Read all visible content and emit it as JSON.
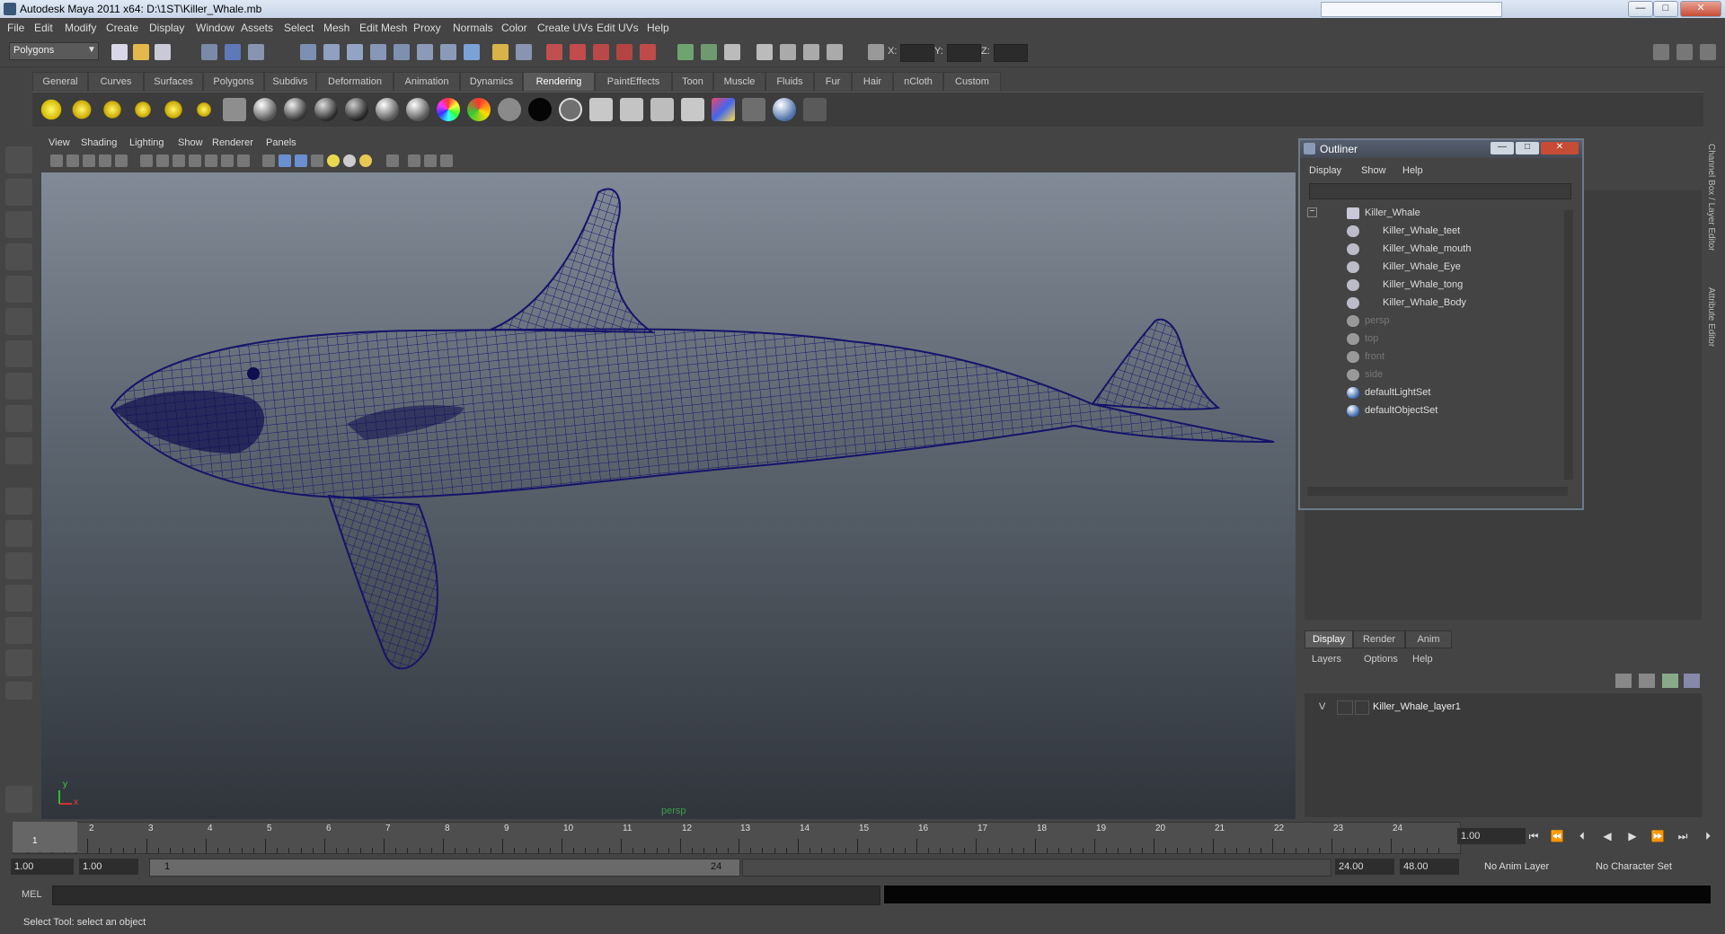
{
  "window": {
    "title": "Autodesk Maya 2011 x64: D:\\1ST\\Killer_Whale.mb",
    "min": "—",
    "max": "□",
    "close": "✕"
  },
  "menubar": [
    "File",
    "Edit",
    "Modify",
    "Create",
    "Display",
    "Window",
    "Assets",
    "Select",
    "Mesh",
    "Edit Mesh",
    "Proxy",
    "Normals",
    "Color",
    "Create UVs",
    "Edit UVs",
    "Help"
  ],
  "statusline": {
    "mode": "Polygons",
    "x_label": "X:",
    "y_label": "Y:",
    "z_label": "Z:"
  },
  "shelf": {
    "tabs": [
      "General",
      "Curves",
      "Surfaces",
      "Polygons",
      "Subdivs",
      "Deformation",
      "Animation",
      "Dynamics",
      "Rendering",
      "PaintEffects",
      "Toon",
      "Muscle",
      "Fluids",
      "Fur",
      "Hair",
      "nCloth",
      "Custom"
    ],
    "active": "Rendering"
  },
  "viewport": {
    "menus": [
      "View",
      "Shading",
      "Lighting",
      "Show",
      "Renderer",
      "Panels"
    ],
    "camera_label": "persp",
    "axis_y": "y",
    "axis_x": "x",
    "wire_color": "#1a1a6e"
  },
  "outliner": {
    "title": "Outliner",
    "menus": [
      "Display",
      "Show",
      "Help"
    ],
    "items": [
      {
        "label": "Killer_Whale",
        "indent": 0,
        "icon": "transform-icon",
        "expand": "−",
        "dim": false
      },
      {
        "label": "Killer_Whale_teet",
        "indent": 1,
        "icon": "mesh-icon",
        "dim": false
      },
      {
        "label": "Killer_Whale_mouth",
        "indent": 1,
        "icon": "mesh-icon",
        "dim": false
      },
      {
        "label": "Killer_Whale_Eye",
        "indent": 1,
        "icon": "mesh-icon",
        "dim": false
      },
      {
        "label": "Killer_Whale_tong",
        "indent": 1,
        "icon": "mesh-icon",
        "dim": false
      },
      {
        "label": "Killer_Whale_Body",
        "indent": 1,
        "icon": "mesh-icon",
        "dim": false
      },
      {
        "label": "persp",
        "indent": 0,
        "icon": "camera-icon",
        "dim": true
      },
      {
        "label": "top",
        "indent": 0,
        "icon": "camera-icon",
        "dim": true
      },
      {
        "label": "front",
        "indent": 0,
        "icon": "camera-icon",
        "dim": true
      },
      {
        "label": "side",
        "indent": 0,
        "icon": "camera-icon",
        "dim": true
      },
      {
        "label": "defaultLightSet",
        "indent": 0,
        "icon": "set-icon",
        "dim": false
      },
      {
        "label": "defaultObjectSet",
        "indent": 0,
        "icon": "set-icon",
        "dim": false
      }
    ]
  },
  "sidetabs": {
    "channel": "Channel Box / Layer Editor",
    "attr": "Attribute Editor"
  },
  "layers": {
    "tabs": [
      "Display",
      "Render",
      "Anim"
    ],
    "active": "Display",
    "menus": [
      "Layers",
      "Options",
      "Help"
    ],
    "rows": [
      {
        "visible": "V",
        "name": "Killer_Whale_layer1"
      }
    ]
  },
  "timeline": {
    "ticks": [
      "1",
      "2",
      "3",
      "4",
      "5",
      "6",
      "7",
      "8",
      "9",
      "10",
      "11",
      "12",
      "13",
      "14",
      "15",
      "16",
      "17",
      "18",
      "19",
      "20",
      "21",
      "22",
      "23",
      "24"
    ],
    "current_frame_marker": "1",
    "current_frame": "1.00"
  },
  "range": {
    "start": "1.00",
    "playback_start": "1.00",
    "slider_start": "1",
    "slider_end": "24",
    "playback_end": "24.00",
    "end": "48.00",
    "anim_layer": "No Anim Layer",
    "char_set": "No Character Set"
  },
  "command": {
    "lang": "MEL"
  },
  "help": {
    "text": "Select Tool: select an object"
  }
}
